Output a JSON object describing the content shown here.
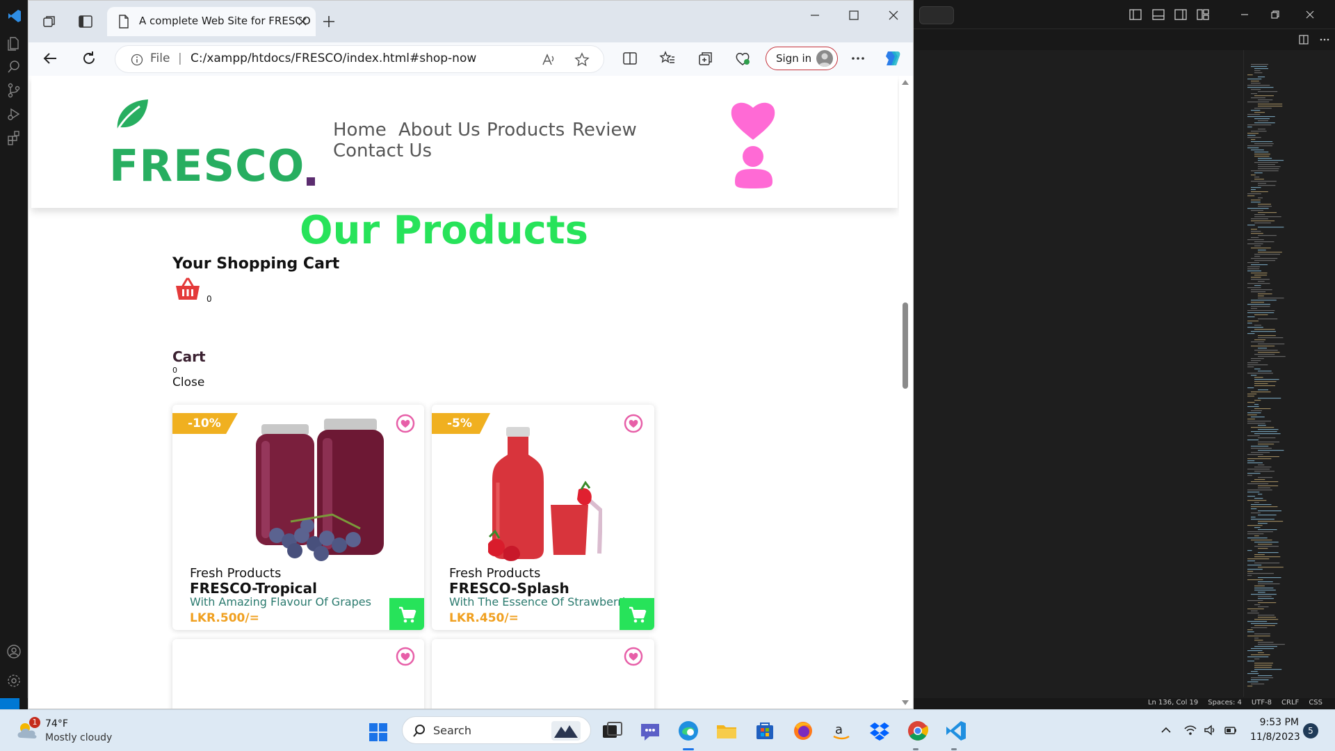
{
  "browser": {
    "tab_title": "A complete Web Site for FRESCO",
    "address_scheme": "File",
    "address_separator": "|",
    "address_url": "C:/xampp/htdocs/FRESCO/index.html#shop-now",
    "signin_label": "Sign in"
  },
  "site": {
    "logo_text": "FRESCO",
    "nav": [
      "Home",
      "About Us",
      "Products",
      "Review",
      "Contact Us"
    ],
    "products_heading": "Our Products",
    "cart_heading": "Your Shopping Cart",
    "basket_count": "0",
    "cart_label": "Cart",
    "cart_count": "0",
    "cart_close": "Close",
    "products": [
      {
        "discount": "-10%",
        "category": "Fresh Products",
        "name": "FRESCO-Tropical",
        "description": "With Amazing Flavour Of Grapes",
        "price": "LKR.500/="
      },
      {
        "discount": "-5%",
        "category": "Fresh Products",
        "name": "FRESCO-Splash",
        "description": "With The Essence Of Strawberries",
        "price": "LKR.450/="
      }
    ]
  },
  "vscode": {
    "status": [
      "Ln 136, Col 19",
      "Spaces: 4",
      "UTF-8",
      "CRLF",
      "CSS"
    ]
  },
  "taskbar": {
    "weather_temp": "74°F",
    "weather_desc": "Mostly cloudy",
    "weather_badge": "1",
    "search_label": "Search",
    "time": "9:53 PM",
    "date": "11/8/2023",
    "notification_count": "5"
  },
  "colors": {
    "brand_green": "#27ae60",
    "heading_green": "#27e35a",
    "price_orange": "#f0a020",
    "accent_pink": "#ff6ad5"
  }
}
